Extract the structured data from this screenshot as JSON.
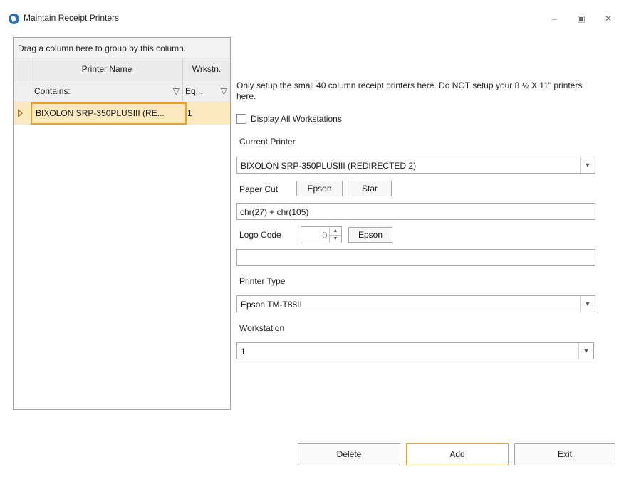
{
  "window": {
    "title": "Maintain Receipt Printers",
    "controls": [
      "minimize-icon",
      "maximize-icon",
      "close-icon"
    ]
  },
  "grid": {
    "group_hint": "Drag a column here to group by this column.",
    "columns": [
      "Printer Name",
      "Wrkstn."
    ],
    "filters": [
      "Contains:",
      "Eq..."
    ],
    "rows": [
      {
        "printer_name": "BIXOLON SRP-350PLUSIII (RE...",
        "wrkstn": "1"
      }
    ]
  },
  "form": {
    "notice": "Only setup the small 40 column receipt printers here. Do NOT setup your 8 ½ X 11\" printers here.",
    "display_all_label": "Display All Workstations",
    "display_all_checked": false,
    "current_printer_label": "Current Printer",
    "current_printer_value": "BIXOLON SRP-350PLUSIII (REDIRECTED 2)",
    "paper_cut_label": "Paper Cut",
    "paper_cut_epson": "Epson",
    "paper_cut_star": "Star",
    "paper_cut_value": "chr(27) + chr(105)",
    "logo_code_label": "Logo Code",
    "logo_code_value": "0",
    "logo_code_epson": "Epson",
    "logo_code_text": "",
    "printer_type_label": "Printer Type",
    "printer_type_value": "Epson TM-T88II",
    "workstation_label": "Workstation",
    "workstation_value": "1"
  },
  "buttons": {
    "delete": "Delete",
    "add": "Add",
    "exit": "Exit"
  },
  "colors": {
    "selected_row": "#fde9c0",
    "focus_border": "#f0a020",
    "app_icon": "#2b6cb0"
  }
}
